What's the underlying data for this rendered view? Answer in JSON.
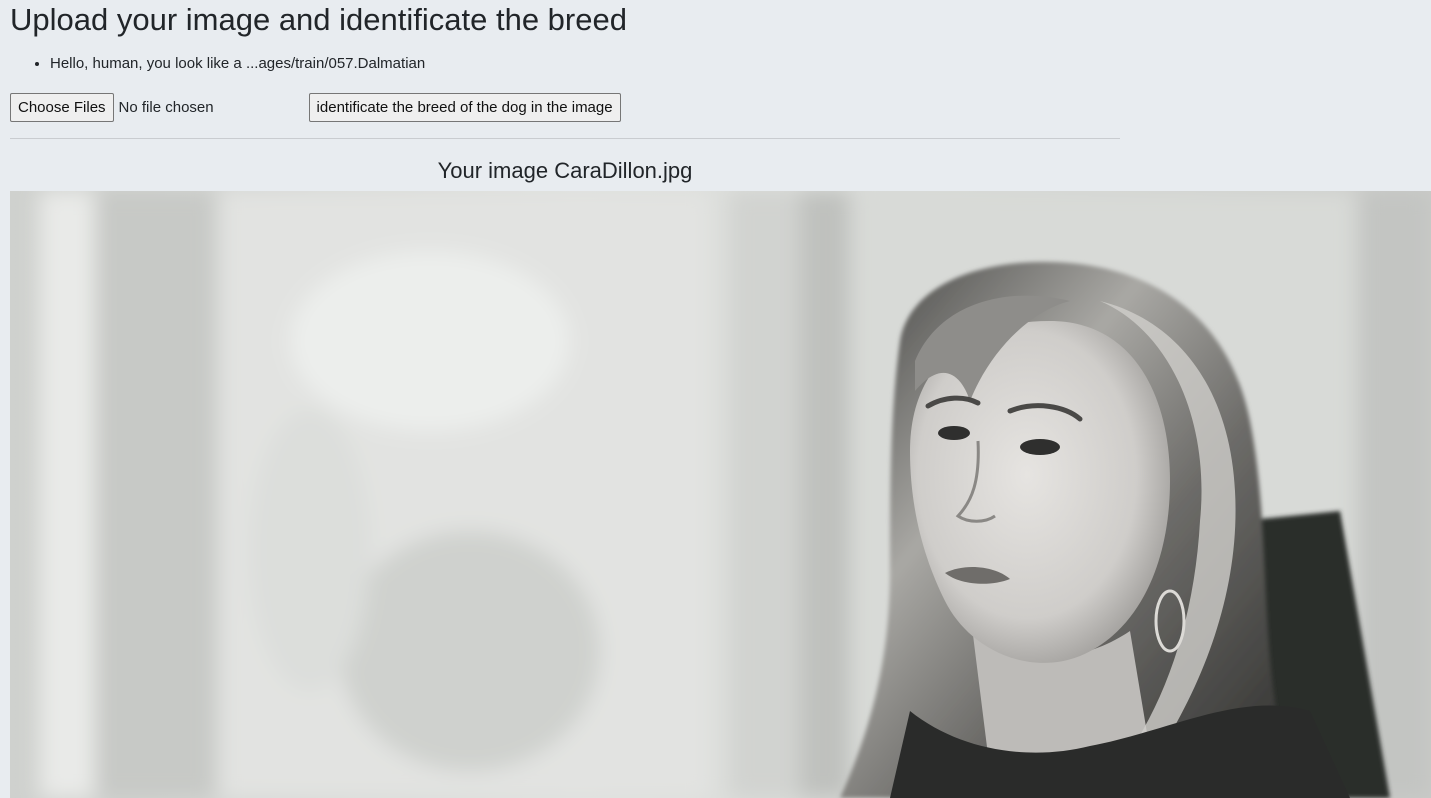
{
  "page": {
    "title": "Upload your image and identificate the breed"
  },
  "messages": [
    "Hello, human, you look like a ...ages/train/057.Dalmatian"
  ],
  "upload": {
    "choose_files_label": "Choose Files",
    "file_status": "No file chosen",
    "submit_label": "identificate the breed of the dog in the image"
  },
  "result": {
    "image_title": "Your image CaraDillon.jpg",
    "image_subject": "black-and-white portrait photo"
  },
  "colors": {
    "page_background": "#e8ecf0",
    "text": "#212529",
    "button_background": "#efefef",
    "button_border": "#767676"
  }
}
